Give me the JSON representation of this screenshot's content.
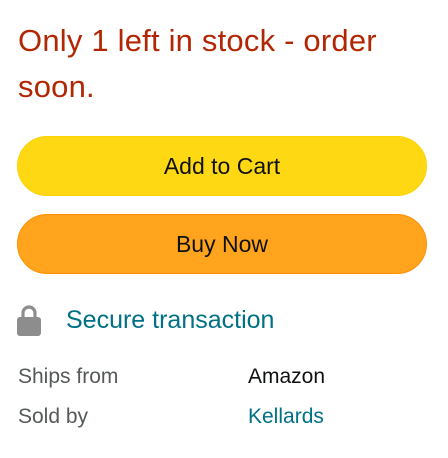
{
  "availability": {
    "message": "Only 1 left in stock - order soon."
  },
  "buttons": {
    "add_to_cart": "Add to Cart",
    "buy_now": "Buy Now"
  },
  "secure": {
    "icon": "lock-icon",
    "label": "Secure transaction"
  },
  "details": [
    {
      "label": "Ships from",
      "value": "Amazon"
    },
    {
      "label": "Sold by",
      "value": "Kellards"
    }
  ],
  "colors": {
    "stock_warning": "#b12704",
    "add_to_cart_bg": "#ffd814",
    "buy_now_bg": "#ffa41c",
    "link": "#007185"
  }
}
